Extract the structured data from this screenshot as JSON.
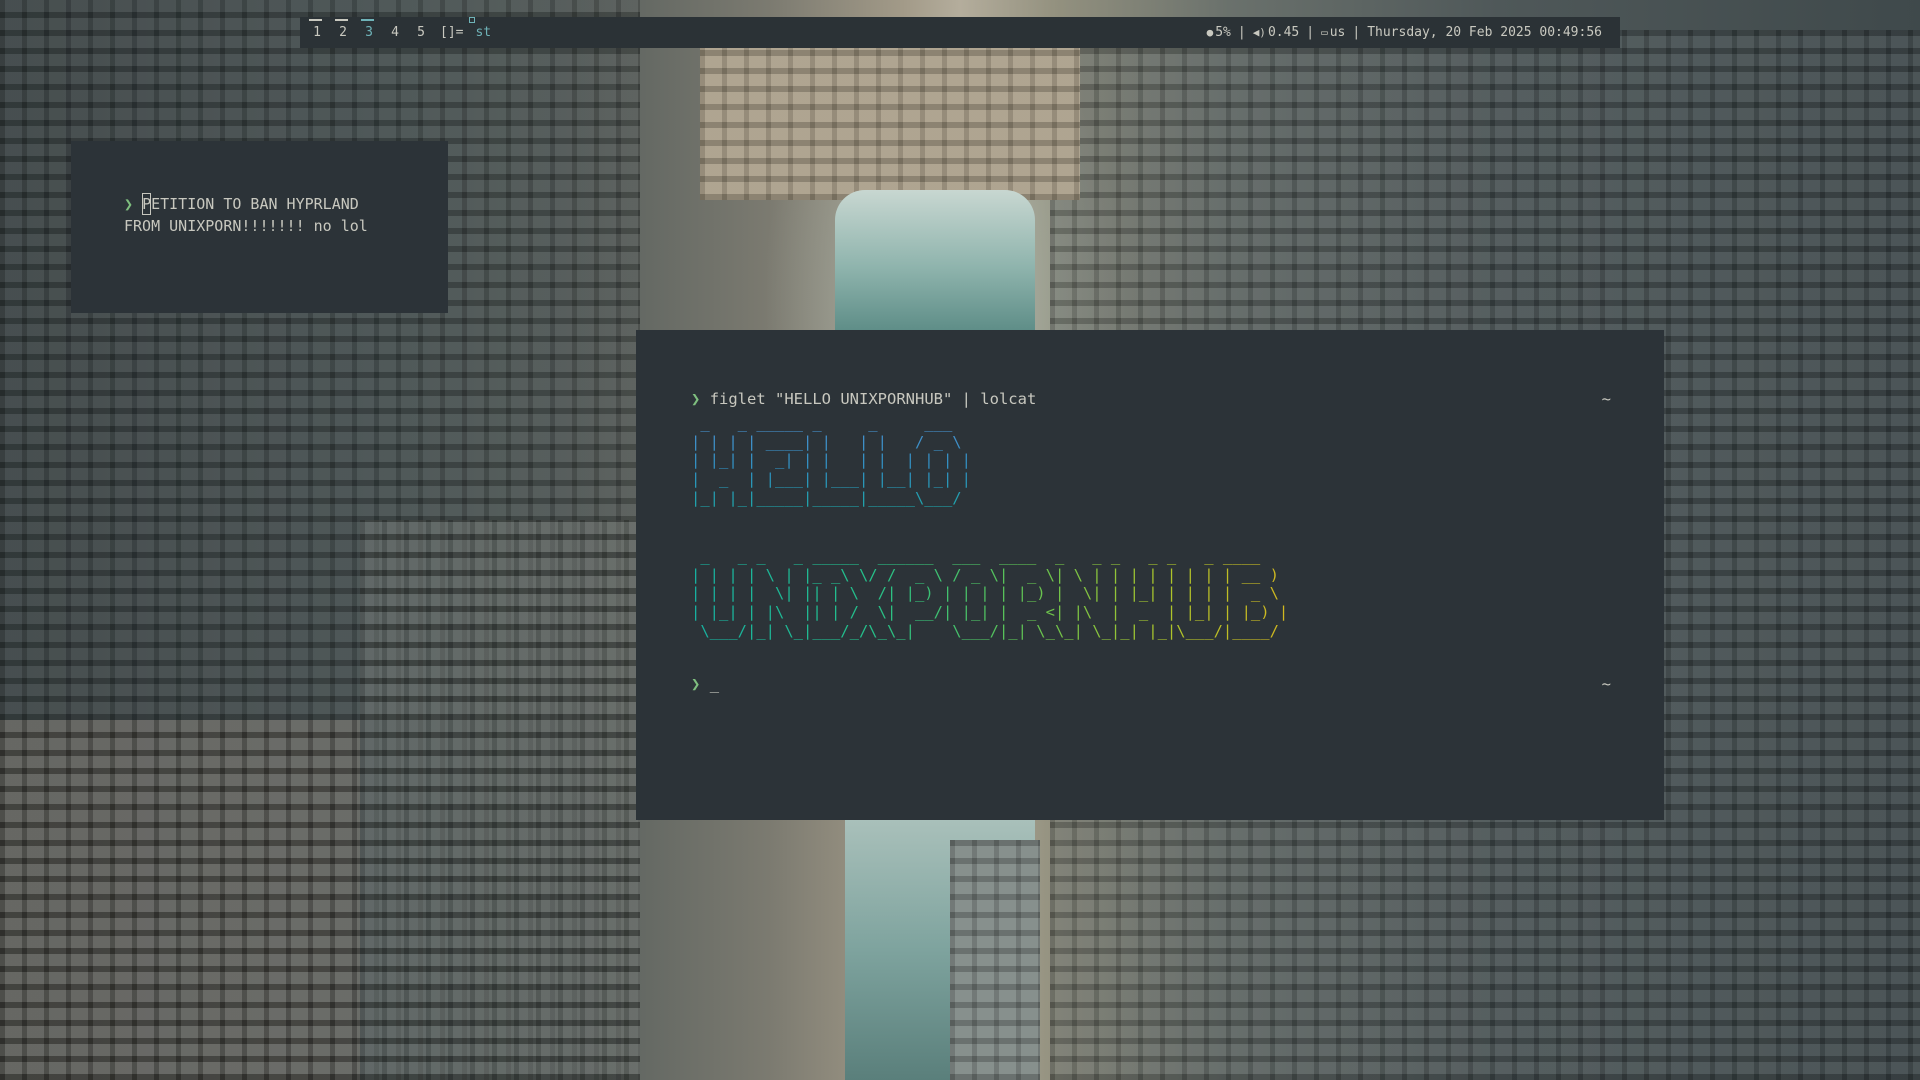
{
  "bar": {
    "tags": [
      {
        "label": "1",
        "occupied": true,
        "active": false
      },
      {
        "label": "2",
        "occupied": true,
        "active": false
      },
      {
        "label": "3",
        "occupied": true,
        "active": true
      },
      {
        "label": "4",
        "occupied": false,
        "active": false
      },
      {
        "label": "5",
        "occupied": false,
        "active": false
      }
    ],
    "layout_symbol": "[]=",
    "window_title": "st",
    "status": {
      "cpu_icon": "cpu-icon",
      "cpu": "5%",
      "volume_icon": "speaker-icon",
      "volume": "0.45",
      "keyboard_icon": "keyboard-icon",
      "keyboard_layout": "us",
      "separator": "|",
      "datetime": "Thursday, 20 Feb 2025 00:49:56"
    }
  },
  "small_terminal": {
    "prompt": "❯",
    "cursor_char": "P",
    "line1_rest": "ETITION TO BAN HYPRLAND",
    "line2": "FROM UNIXPORN!!!!!!! no lol"
  },
  "main_terminal": {
    "prompt": "❯",
    "command": "figlet \"HELLO UNIXPORNHUB\" | lolcat",
    "cwd": "~",
    "figlet_hello": " _   _ _____ _     _     ___  \n| | | | ____| |   | |   / _ \\ \n| |_| |  _| | |   | |  | | | |\n|  _  | |___| |___| |__| |_| |\n|_| |_|_____|_____|_____\\___/ ",
    "figlet_unixpornhub": " _   _ _   _ _____  ______  ___  ____  _   _ _   _ _   _ ____  \n| | | | \\ | |_ _\\ \\/ /  _ \\ / _ \\|  _ \\| \\ | | | | | | | | __ ) \n| | | |  \\| || | \\  /| |_) | | | | |_) |  \\| | |_| | | | |  _ \\ \n| |_| | |\\  || | /  \\|  __/| |_| |  _ <| |\\  |  _  | |_| | |_) |\n \\___/|_| \\_|___/_/\\_\\_|    \\___/|_| \\_\\_| \\_|_| |_|\\___/|____/ ",
    "next_prompt": "❯",
    "next_cursor": "_",
    "next_cwd": "~"
  }
}
